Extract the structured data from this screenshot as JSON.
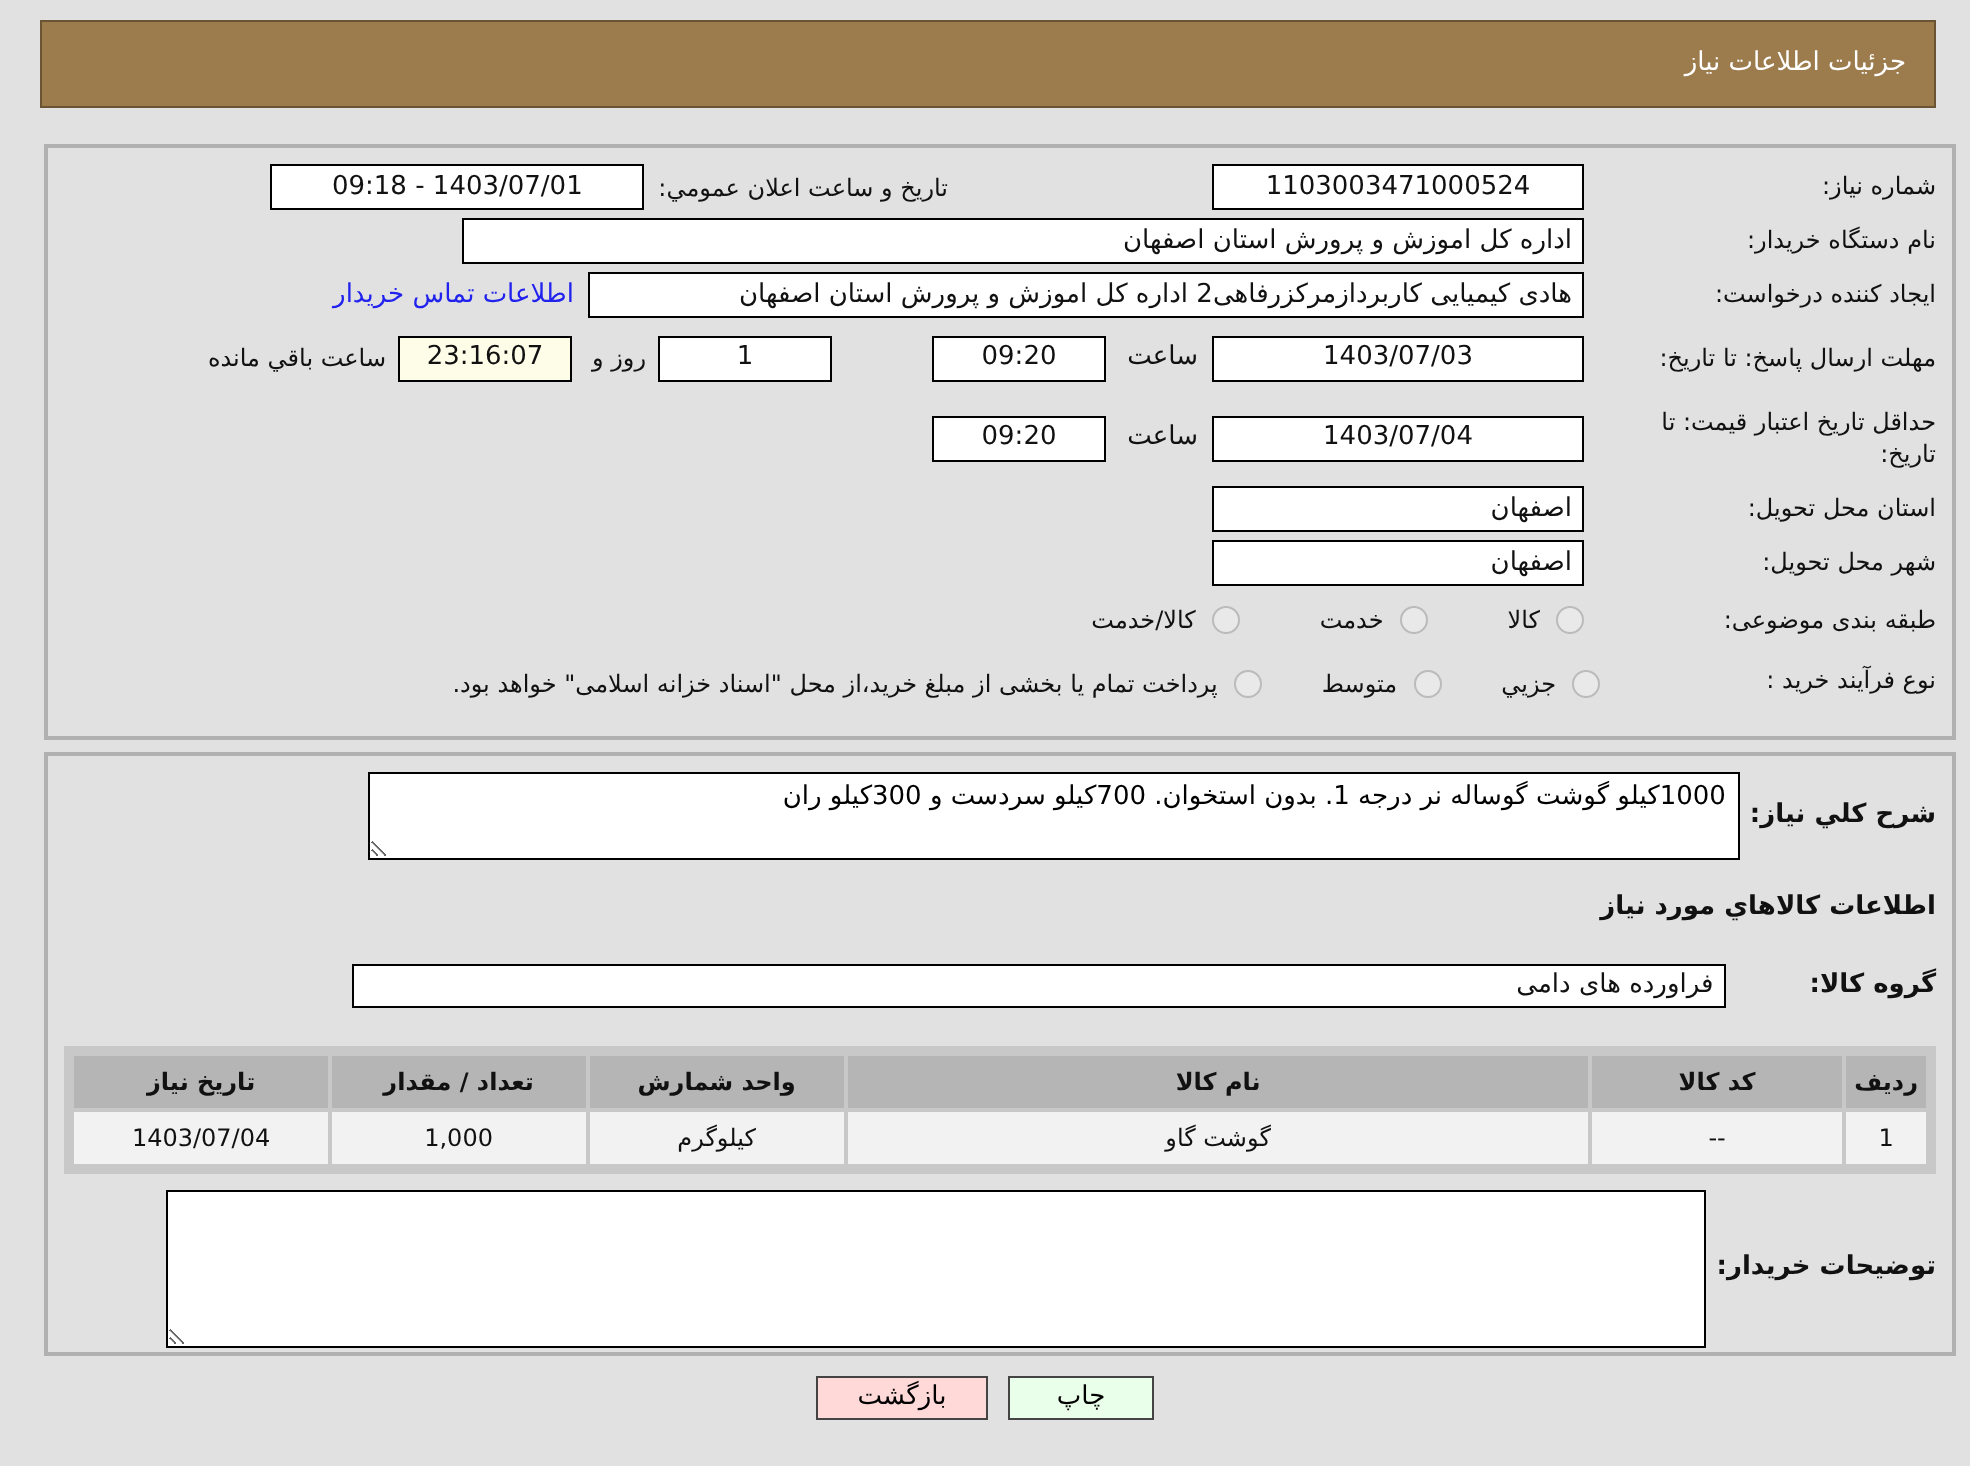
{
  "header": {
    "title": "جزئیات اطلاعات نیاز"
  },
  "need_number": {
    "label": "شماره نیاز:",
    "value": "1103003471000524"
  },
  "announce": {
    "label": "تاریخ و ساعت اعلان عمومي:",
    "value": "1403/07/01 - 09:18"
  },
  "buyer": {
    "label": "نام دستگاه خریدار:",
    "value": "اداره کل اموزش و پرورش استان اصفهان"
  },
  "creator": {
    "label": "ایجاد کننده درخواست:",
    "value": "هادی کیمیایی کاربردازمرکزرفاهی2 اداره کل اموزش و پرورش استان اصفهان",
    "link": "اطلاعات تماس خریدار"
  },
  "reply_deadline": {
    "label": "مهلت ارسال پاسخ: تا تاریخ:",
    "date": "1403/07/03",
    "time_label": "ساعت",
    "time": "09:20",
    "days": "1",
    "days_label": "روز و",
    "remaining": "23:16:07",
    "remaining_label": "ساعت باقي مانده"
  },
  "price_validity": {
    "label": "حداقل تاریخ اعتبار قیمت: تا تاریخ:",
    "date": "1403/07/04",
    "time_label": "ساعت",
    "time": "09:20"
  },
  "province": {
    "label": "استان محل تحویل:",
    "value": "اصفهان"
  },
  "city": {
    "label": "شهر محل تحویل:",
    "value": "اصفهان"
  },
  "category": {
    "label": "طبقه بندی موضوعی:",
    "options": [
      {
        "label": "کالا",
        "selected": false
      },
      {
        "label": "خدمت",
        "selected": false
      },
      {
        "label": "کالا/خدمت",
        "selected": false
      }
    ]
  },
  "purchase_type": {
    "label": "نوع فرآیند خرید :",
    "options": [
      {
        "label": "جزيي",
        "selected": false
      },
      {
        "label": "متوسط",
        "selected": false
      },
      {
        "label": "پرداخت تمام یا بخشی از مبلغ خرید،از محل \"اسناد خزانه اسلامی\" خواهد بود.",
        "selected": false
      }
    ]
  },
  "description": {
    "label": "شرح کلي نیاز:",
    "value": "1000کیلو گوشت گوساله نر درجه 1. بدون استخوان. 700کیلو سردست و 300کیلو ران"
  },
  "goods_title": "اطلاعات کالاهاي مورد نیاز",
  "goods_group": {
    "label": "گروه کالا:",
    "value": "فراورده های دامی"
  },
  "table": {
    "columns": [
      "ردیف",
      "کد کالا",
      "نام کالا",
      "واحد شمارش",
      "تعداد / مقدار",
      "تاریخ نیاز"
    ],
    "rows": [
      [
        "1",
        "--",
        "گوشت گاو",
        "کیلوگرم",
        "1,000",
        "1403/07/04"
      ]
    ]
  },
  "buyer_notes": {
    "label": "توضیحات خریدار:"
  },
  "buttons": [
    {
      "label": "چاپ",
      "kind": "print"
    },
    {
      "label": "بازگشت",
      "kind": "back"
    }
  ]
}
